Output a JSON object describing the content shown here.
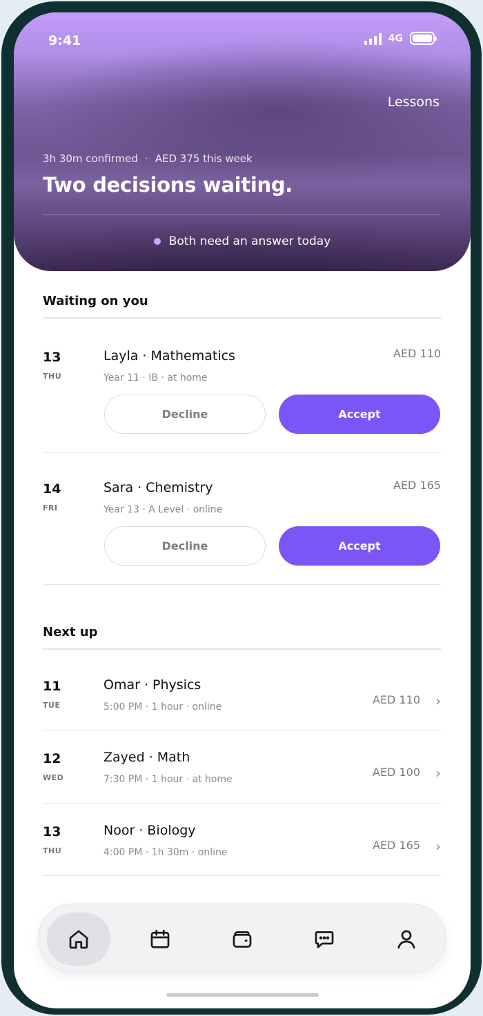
{
  "status_bar": {
    "time": "9:41",
    "network": "4G"
  },
  "hero": {
    "link": "Lessons",
    "confirmed": "3h 30m confirmed",
    "separator": "·",
    "earnings": "AED 375 this week",
    "title": "Two decisions waiting.",
    "note": "Both need an answer today"
  },
  "waiting": {
    "title": "Waiting on you",
    "items": [
      {
        "day": "13",
        "weekday": "THU",
        "title": "Layla · Mathematics",
        "sub": "Year 11 · IB · at home",
        "price": "AED 110",
        "decline": "Decline",
        "accept": "Accept"
      },
      {
        "day": "14",
        "weekday": "FRI",
        "title": "Sara · Chemistry",
        "sub": "Year 13 · A Level · online",
        "price": "AED 165",
        "decline": "Decline",
        "accept": "Accept"
      }
    ]
  },
  "next_up": {
    "title": "Next up",
    "items": [
      {
        "day": "11",
        "weekday": "TUE",
        "title": "Omar · Physics",
        "sub": "5:00 PM · 1 hour · online",
        "price": "AED 110"
      },
      {
        "day": "12",
        "weekday": "WED",
        "title": "Zayed · Math",
        "sub": "7:30 PM · 1 hour · at home",
        "price": "AED 100"
      },
      {
        "day": "13",
        "weekday": "THU",
        "title": "Noor · Biology",
        "sub": "4:00 PM · 1h 30m · online",
        "price": "AED 165"
      }
    ]
  },
  "tab_bar": {
    "active": "home",
    "tabs": [
      {
        "icon": "home-icon"
      },
      {
        "icon": "calendar-icon"
      },
      {
        "icon": "wallet-icon"
      },
      {
        "icon": "chat-icon"
      },
      {
        "icon": "profile-icon"
      }
    ]
  },
  "colors": {
    "accent": "#7b55f6",
    "hero_dot": "#c9a6ff",
    "frame": "#0f2f31"
  }
}
